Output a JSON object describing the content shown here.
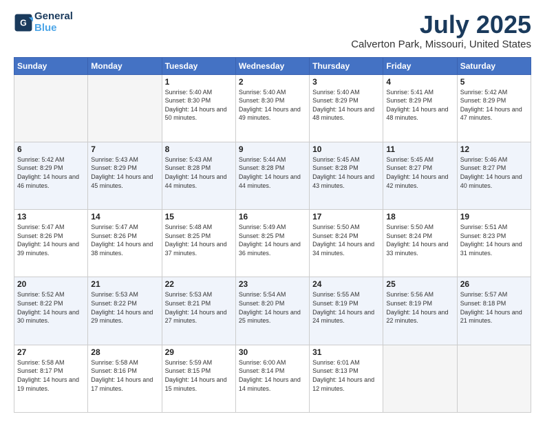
{
  "header": {
    "logo_line1": "General",
    "logo_line2": "Blue",
    "month_title": "July 2025",
    "location": "Calverton Park, Missouri, United States"
  },
  "days_of_week": [
    "Sunday",
    "Monday",
    "Tuesday",
    "Wednesday",
    "Thursday",
    "Friday",
    "Saturday"
  ],
  "weeks": [
    [
      {
        "day": "",
        "info": ""
      },
      {
        "day": "",
        "info": ""
      },
      {
        "day": "1",
        "info": "Sunrise: 5:40 AM\nSunset: 8:30 PM\nDaylight: 14 hours and 50 minutes."
      },
      {
        "day": "2",
        "info": "Sunrise: 5:40 AM\nSunset: 8:30 PM\nDaylight: 14 hours and 49 minutes."
      },
      {
        "day": "3",
        "info": "Sunrise: 5:40 AM\nSunset: 8:29 PM\nDaylight: 14 hours and 48 minutes."
      },
      {
        "day": "4",
        "info": "Sunrise: 5:41 AM\nSunset: 8:29 PM\nDaylight: 14 hours and 48 minutes."
      },
      {
        "day": "5",
        "info": "Sunrise: 5:42 AM\nSunset: 8:29 PM\nDaylight: 14 hours and 47 minutes."
      }
    ],
    [
      {
        "day": "6",
        "info": "Sunrise: 5:42 AM\nSunset: 8:29 PM\nDaylight: 14 hours and 46 minutes."
      },
      {
        "day": "7",
        "info": "Sunrise: 5:43 AM\nSunset: 8:29 PM\nDaylight: 14 hours and 45 minutes."
      },
      {
        "day": "8",
        "info": "Sunrise: 5:43 AM\nSunset: 8:28 PM\nDaylight: 14 hours and 44 minutes."
      },
      {
        "day": "9",
        "info": "Sunrise: 5:44 AM\nSunset: 8:28 PM\nDaylight: 14 hours and 44 minutes."
      },
      {
        "day": "10",
        "info": "Sunrise: 5:45 AM\nSunset: 8:28 PM\nDaylight: 14 hours and 43 minutes."
      },
      {
        "day": "11",
        "info": "Sunrise: 5:45 AM\nSunset: 8:27 PM\nDaylight: 14 hours and 42 minutes."
      },
      {
        "day": "12",
        "info": "Sunrise: 5:46 AM\nSunset: 8:27 PM\nDaylight: 14 hours and 40 minutes."
      }
    ],
    [
      {
        "day": "13",
        "info": "Sunrise: 5:47 AM\nSunset: 8:26 PM\nDaylight: 14 hours and 39 minutes."
      },
      {
        "day": "14",
        "info": "Sunrise: 5:47 AM\nSunset: 8:26 PM\nDaylight: 14 hours and 38 minutes."
      },
      {
        "day": "15",
        "info": "Sunrise: 5:48 AM\nSunset: 8:25 PM\nDaylight: 14 hours and 37 minutes."
      },
      {
        "day": "16",
        "info": "Sunrise: 5:49 AM\nSunset: 8:25 PM\nDaylight: 14 hours and 36 minutes."
      },
      {
        "day": "17",
        "info": "Sunrise: 5:50 AM\nSunset: 8:24 PM\nDaylight: 14 hours and 34 minutes."
      },
      {
        "day": "18",
        "info": "Sunrise: 5:50 AM\nSunset: 8:24 PM\nDaylight: 14 hours and 33 minutes."
      },
      {
        "day": "19",
        "info": "Sunrise: 5:51 AM\nSunset: 8:23 PM\nDaylight: 14 hours and 31 minutes."
      }
    ],
    [
      {
        "day": "20",
        "info": "Sunrise: 5:52 AM\nSunset: 8:22 PM\nDaylight: 14 hours and 30 minutes."
      },
      {
        "day": "21",
        "info": "Sunrise: 5:53 AM\nSunset: 8:22 PM\nDaylight: 14 hours and 29 minutes."
      },
      {
        "day": "22",
        "info": "Sunrise: 5:53 AM\nSunset: 8:21 PM\nDaylight: 14 hours and 27 minutes."
      },
      {
        "day": "23",
        "info": "Sunrise: 5:54 AM\nSunset: 8:20 PM\nDaylight: 14 hours and 25 minutes."
      },
      {
        "day": "24",
        "info": "Sunrise: 5:55 AM\nSunset: 8:19 PM\nDaylight: 14 hours and 24 minutes."
      },
      {
        "day": "25",
        "info": "Sunrise: 5:56 AM\nSunset: 8:19 PM\nDaylight: 14 hours and 22 minutes."
      },
      {
        "day": "26",
        "info": "Sunrise: 5:57 AM\nSunset: 8:18 PM\nDaylight: 14 hours and 21 minutes."
      }
    ],
    [
      {
        "day": "27",
        "info": "Sunrise: 5:58 AM\nSunset: 8:17 PM\nDaylight: 14 hours and 19 minutes."
      },
      {
        "day": "28",
        "info": "Sunrise: 5:58 AM\nSunset: 8:16 PM\nDaylight: 14 hours and 17 minutes."
      },
      {
        "day": "29",
        "info": "Sunrise: 5:59 AM\nSunset: 8:15 PM\nDaylight: 14 hours and 15 minutes."
      },
      {
        "day": "30",
        "info": "Sunrise: 6:00 AM\nSunset: 8:14 PM\nDaylight: 14 hours and 14 minutes."
      },
      {
        "day": "31",
        "info": "Sunrise: 6:01 AM\nSunset: 8:13 PM\nDaylight: 14 hours and 12 minutes."
      },
      {
        "day": "",
        "info": ""
      },
      {
        "day": "",
        "info": ""
      }
    ]
  ]
}
